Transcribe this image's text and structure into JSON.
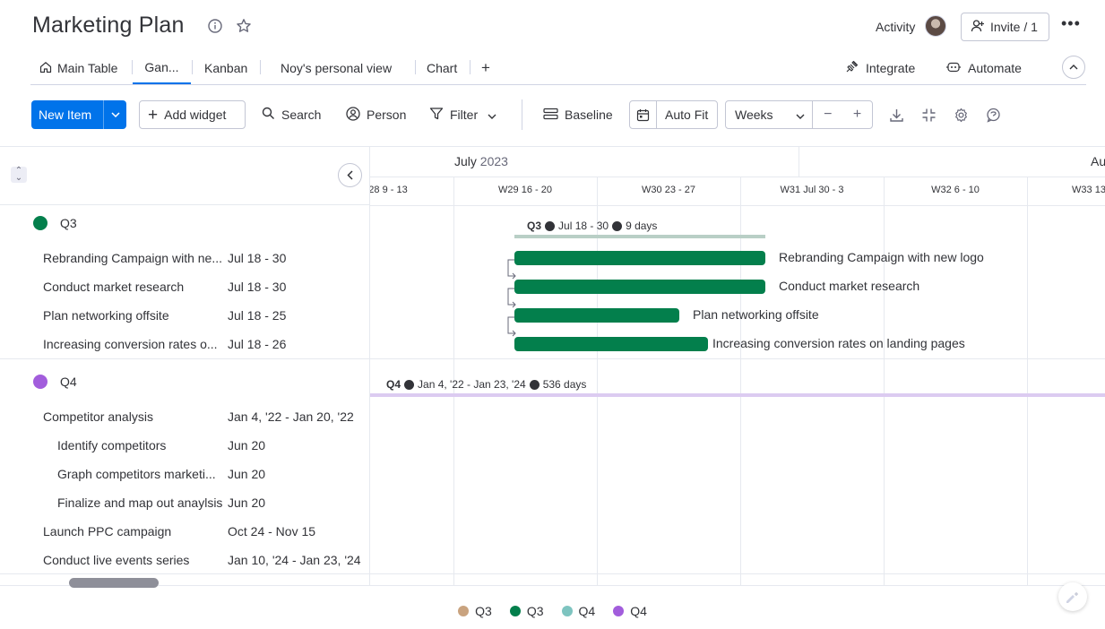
{
  "header": {
    "title": "Marketing Plan",
    "activity_label": "Activity",
    "invite_label": "Invite / 1"
  },
  "tabs": [
    {
      "label": "Main Table"
    },
    {
      "label": "Gan..."
    },
    {
      "label": "Kanban"
    },
    {
      "label": "Noy's personal view"
    },
    {
      "label": "Chart"
    }
  ],
  "tabs_right": {
    "integrate_label": "Integrate",
    "automate_label": "Automate"
  },
  "toolbar": {
    "new_item_label": "New Item",
    "add_widget_label": "Add widget",
    "search_label": "Search",
    "person_label": "Person",
    "filter_label": "Filter",
    "baseline_label": "Baseline",
    "autofit_label": "Auto Fit",
    "weeks_label": "Weeks"
  },
  "timeline": {
    "months": [
      {
        "name": "July",
        "year": "2023"
      },
      {
        "name": "Au",
        "year": ""
      }
    ],
    "weeks": [
      "28 9 - 13",
      "W29 16 - 20",
      "W30 23 - 27",
      "W31 Jul 30 - 3",
      "W32 6 - 10",
      "W33 13"
    ]
  },
  "groups": [
    {
      "name": "Q3",
      "color": "#037f4c",
      "summary_dates": "Jul 18 - 30",
      "summary_days": "9 days",
      "items": [
        {
          "name": "Rebranding Campaign with new logo",
          "short": "Rebranding Campaign with ne...",
          "date": "Jul 18 - 30"
        },
        {
          "name": "Conduct market research",
          "short": "Conduct market research",
          "date": "Jul 18 - 30"
        },
        {
          "name": "Plan networking offsite",
          "short": "Plan networking offsite",
          "date": "Jul 18 - 25"
        },
        {
          "name": "Increasing conversion rates on landing pages",
          "short": "Increasing conversion rates o...",
          "date": "Jul 18 - 26"
        }
      ]
    },
    {
      "name": "Q4",
      "color": "#a25ddc",
      "summary_dates": "Jan 4, '22 - Jan 23, '24",
      "summary_days": "536 days",
      "items": [
        {
          "name": "Competitor analysis",
          "short": "Competitor analysis",
          "date": "Jan 4, '22 - Jan 20, '22"
        },
        {
          "name": "Identify competitors",
          "short": "Identify competitors",
          "date": "Jun 20"
        },
        {
          "name": "Graph competitors marketi...",
          "short": "Graph competitors marketi...",
          "date": "Jun 20"
        },
        {
          "name": "Finalize and map out anaylsis",
          "short": "Finalize and map out anaylsis",
          "date": "Jun 20"
        },
        {
          "name": "Launch PPC campaign",
          "short": "Launch PPC campaign",
          "date": "Oct 24 - Nov 15"
        },
        {
          "name": "Conduct live events series",
          "short": "Conduct live events series",
          "date": "Jan 10, '24 - Jan 23, '24"
        }
      ]
    }
  ],
  "legend": [
    {
      "label": "Q3",
      "color": "#c9a37f"
    },
    {
      "label": "Q3",
      "color": "#037f4c"
    },
    {
      "label": "Q4",
      "color": "#7ec4c0"
    },
    {
      "label": "Q4",
      "color": "#a25ddc"
    }
  ]
}
